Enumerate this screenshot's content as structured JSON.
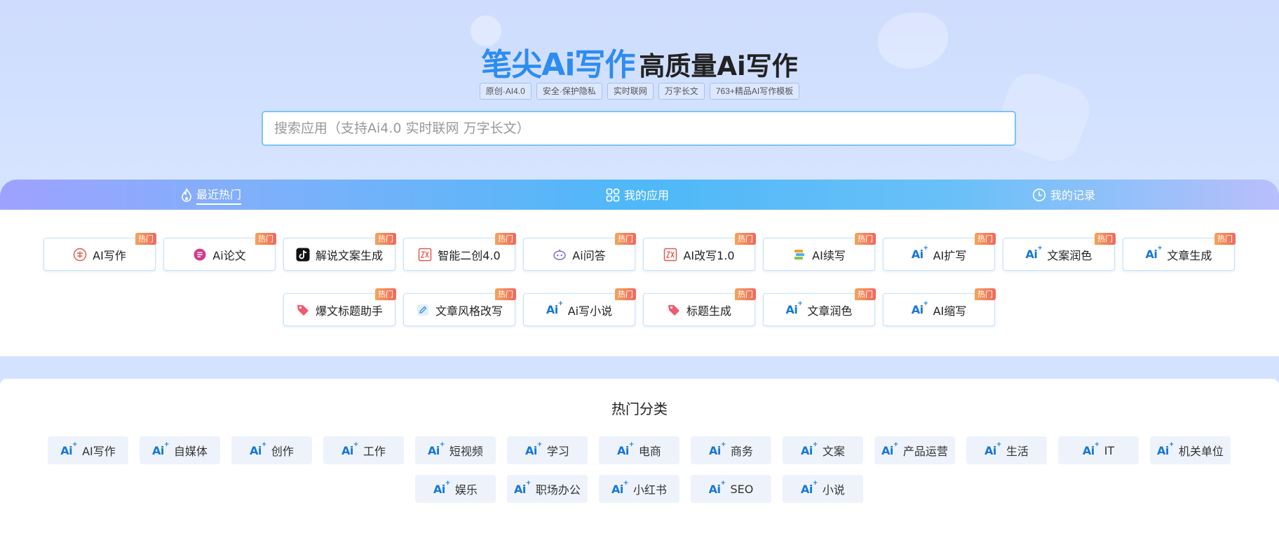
{
  "hero": {
    "brand": "笔尖Ai写作",
    "subtitle": "高质量Ai写作",
    "tags": [
      "原创·AI4.0",
      "安全·保护隐私",
      "实时联网",
      "万字长文",
      "763+精品AI写作模板"
    ],
    "search_placeholder": "搜索应用（支持Ai4.0 实时联网 万字长文）"
  },
  "tabs": [
    {
      "label": "最近热门",
      "icon": "flame-icon",
      "active": true
    },
    {
      "label": "我的应用",
      "icon": "grid-icon",
      "active": false
    },
    {
      "label": "我的记录",
      "icon": "clock-icon",
      "active": false
    }
  ],
  "hot_badge": "热门",
  "hot_apps": [
    {
      "label": "AI写作",
      "icon": "write-seal-icon",
      "color": "#e05a4f"
    },
    {
      "label": "Ai论文",
      "icon": "paper-circle-icon",
      "color": "#d23a8c"
    },
    {
      "label": "解说文案生成",
      "icon": "tiktok-icon",
      "color": "#111111"
    },
    {
      "label": "智能二创4.0",
      "icon": "rewrite-box-icon",
      "color": "#e05a4f"
    },
    {
      "label": "Ai问答",
      "icon": "chat-robot-icon",
      "color": "#7a6ae0"
    },
    {
      "label": "AI改写1.0",
      "icon": "rewrite-box-icon",
      "color": "#e05a4f"
    },
    {
      "label": "AI续写",
      "icon": "stack-icon",
      "color": "#f0a030"
    },
    {
      "label": "AI扩写",
      "icon": "ai-spark-icon",
      "color": "#1677d8"
    },
    {
      "label": "文案润色",
      "icon": "ai-spark-icon",
      "color": "#1677d8"
    },
    {
      "label": "文章生成",
      "icon": "ai-spark-icon",
      "color": "#1677d8"
    },
    {
      "label": "爆文标题助手",
      "icon": "tag-icon",
      "color": "#f05a6e"
    },
    {
      "label": "文章风格改写",
      "icon": "edit-square-icon",
      "color": "#3b8fe8"
    },
    {
      "label": "Ai写小说",
      "icon": "ai-spark-icon",
      "color": "#1677d8"
    },
    {
      "label": "标题生成",
      "icon": "tag-icon",
      "color": "#f05a6e"
    },
    {
      "label": "文章润色",
      "icon": "ai-spark-icon",
      "color": "#1677d8"
    },
    {
      "label": "AI缩写",
      "icon": "ai-spark-icon",
      "color": "#1677d8"
    }
  ],
  "category_title": "热门分类",
  "categories": [
    "AI写作",
    "自媒体",
    "创作",
    "工作",
    "短视频",
    "学习",
    "电商",
    "商务",
    "文案",
    "产品运营",
    "生活",
    "IT",
    "机关单位",
    "娱乐",
    "职场办公",
    "小红书",
    "SEO",
    "小说"
  ],
  "ai_icon_text": "Ai",
  "colors": {
    "brand_blue": "#2d8cf0",
    "badge_gradient_start": "#f4a45a",
    "badge_gradient_end": "#f0685d",
    "ai_icon": "#1677d8"
  }
}
